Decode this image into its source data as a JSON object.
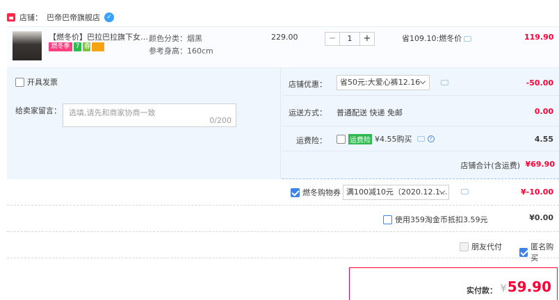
{
  "shop": {
    "label": "店铺：",
    "name": "巴帝巴帝旗舰店"
  },
  "item": {
    "title": "【燃冬价】巴拉巴拉旗下女童裤...",
    "tags": [
      "燃冬季",
      "7",
      "春"
    ],
    "sku_color": "颜色分类：烟黑",
    "sku_height": "参考身高：160cm",
    "unit_price": "229.00",
    "quantity": "1",
    "qty_minus": "−",
    "qty_plus": "+",
    "promo": "省109.10:燃冬价",
    "total": "119.90"
  },
  "invoice": {
    "label": "开具发票"
  },
  "message": {
    "label": "给卖家留言：",
    "placeholder": "选填,请先和商家协商一致",
    "count": "0/200"
  },
  "shop_discount": {
    "label": "店铺优惠：",
    "selected": "省50元:大爱心裤12.16",
    "amount": "-50.00"
  },
  "shipping": {
    "label": "运送方式：",
    "value": "普通配送 快递 免邮",
    "amount": "0.00"
  },
  "freight_insurance": {
    "label": "运费险：",
    "tag": "运费险",
    "value": "¥4.55购买",
    "help": "?",
    "amount": "4.55"
  },
  "shop_total": {
    "label": "店铺合计(含运费)",
    "value": "¥69.90"
  },
  "coupon": {
    "label": "燃冬购物券",
    "selected": "满100减10元（2020.12.1...",
    "amount": "¥-10.00"
  },
  "taojinbi": {
    "label": "使用359淘金币抵扣3.59元",
    "amount": "¥0.00"
  },
  "friend_pay": {
    "label": "朋友代付"
  },
  "anonymous": {
    "label": "匿名购买"
  },
  "payment": {
    "label": "实付款：",
    "currency": "¥",
    "value": "59.90"
  },
  "colors": {
    "accent_red": "#ff0036",
    "accent_blue": "#3f82e8"
  }
}
